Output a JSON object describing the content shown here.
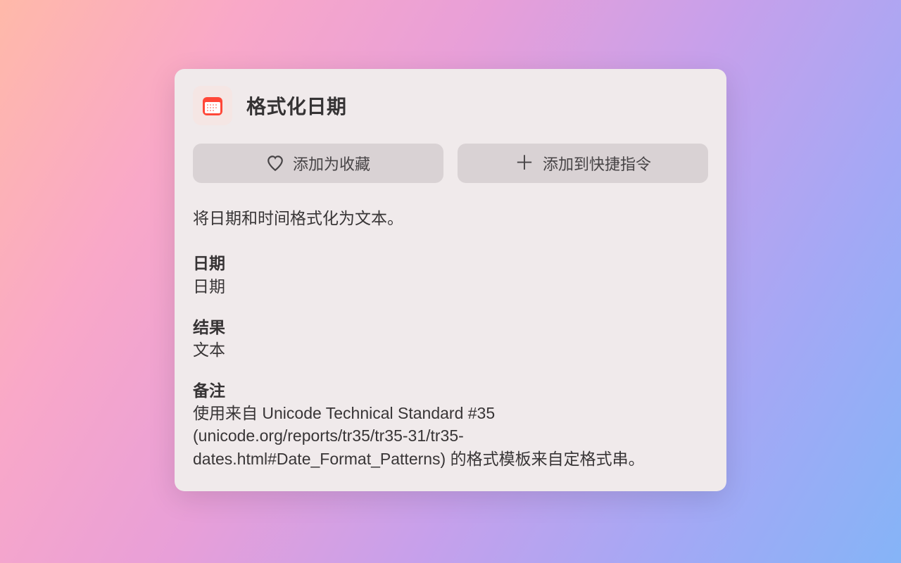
{
  "header": {
    "title": "格式化日期"
  },
  "buttons": {
    "favorite": "添加为收藏",
    "shortcut": "添加到快捷指令"
  },
  "description": "将日期和时间格式化为文本。",
  "sections": {
    "date_label": "日期",
    "date_value": "日期",
    "result_label": "结果",
    "result_value": "文本",
    "notes_label": "备注",
    "notes_value": "使用来自 Unicode Technical Standard #35 (unicode.org/reports/tr35/tr35-31/tr35-dates.html#Date_Format_Patterns) 的格式模板来自定格式串。"
  }
}
